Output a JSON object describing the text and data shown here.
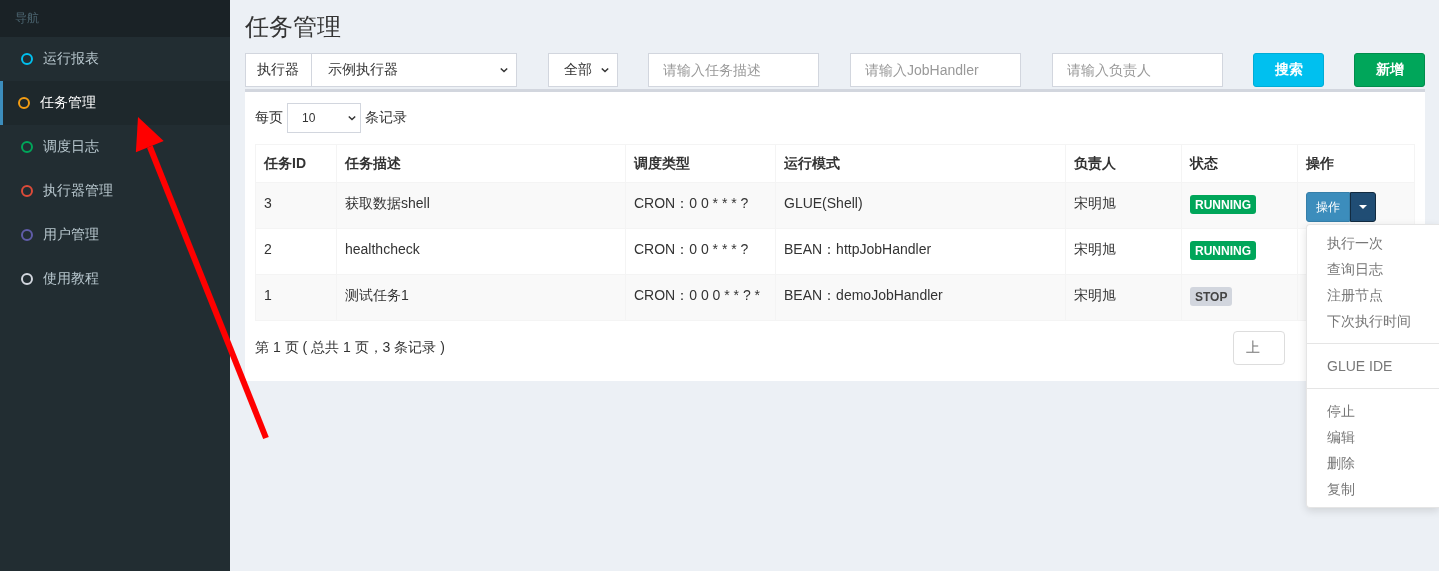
{
  "sidebar": {
    "header": "导航",
    "items": [
      {
        "label": "运行报表",
        "color": "#00c0ef",
        "selected": false
      },
      {
        "label": "任务管理",
        "color": "#f39c12",
        "selected": true
      },
      {
        "label": "调度日志",
        "color": "#00a65a",
        "selected": false
      },
      {
        "label": "执行器管理",
        "color": "#dd4b39",
        "selected": false
      },
      {
        "label": "用户管理",
        "color": "#605ca8",
        "selected": false
      },
      {
        "label": "使用教程",
        "color": "#d2d6de",
        "selected": false
      }
    ]
  },
  "page_title": "任务管理",
  "filters": {
    "executor_label": "执行器",
    "executor": "示例执行器",
    "status": "全部",
    "task_desc_placeholder": "请输入任务描述",
    "handler_placeholder": "请输入JobHandler",
    "owner_placeholder": "请输入负责人",
    "buttons": [
      {
        "label": "搜索",
        "kind": "search"
      },
      {
        "label": "新增",
        "kind": "add"
      }
    ]
  },
  "page_size": {
    "prefix": "每页",
    "value": "10",
    "suffix": "条记录"
  },
  "table": {
    "columns": [
      "任务ID",
      "任务描述",
      "调度类型",
      "运行模式",
      "负责人",
      "状态",
      "操作"
    ],
    "rows": [
      {
        "id": "3",
        "desc": "获取数据shell",
        "schedule": "CRON：0 0 * * * ?",
        "mode": "GLUE(Shell)",
        "owner": "宋明旭",
        "status": "RUNNING",
        "kind": "running",
        "action": "操作"
      },
      {
        "id": "2",
        "desc": "healthcheck",
        "schedule": "CRON：0 0 * * * ?",
        "mode": "BEAN：httpJobHandler",
        "owner": "宋明旭",
        "status": "RUNNING",
        "kind": "running"
      },
      {
        "id": "1",
        "desc": "测试任务1",
        "schedule": "CRON：0 0 0 * * ? *",
        "mode": "BEAN：demoJobHandler",
        "owner": "宋明旭",
        "status": "STOP",
        "kind": "stop"
      }
    ]
  },
  "pager_info": "第 1 页 ( 总共 1 页，3 条记录 )",
  "pager_button": "上",
  "action_menu": {
    "groups": [
      [
        "执行一次",
        "查询日志",
        "注册节点",
        "下次执行时间"
      ],
      [
        "GLUE IDE"
      ],
      [
        "停止",
        "编辑",
        "删除",
        "复制"
      ]
    ]
  }
}
